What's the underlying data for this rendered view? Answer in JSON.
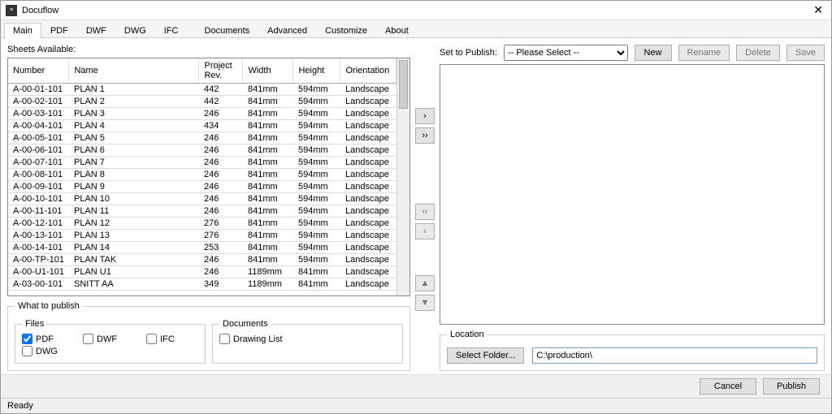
{
  "window": {
    "title": "Docuflow",
    "close_glyph": "✕"
  },
  "tabs": [
    "Main",
    "PDF",
    "DWF",
    "DWG",
    "IFC",
    "Documents",
    "Advanced",
    "Customize",
    "About"
  ],
  "active_tab": 0,
  "left": {
    "sheets_label": "Sheets Available:",
    "columns": {
      "number": "Number",
      "name": "Name",
      "rev": "Project Rev.",
      "width": "Width",
      "height": "Height",
      "orientation": "Orientation"
    },
    "rows": [
      {
        "num": "A-00-01-101",
        "name": "PLAN 1",
        "rev": "442",
        "w": "841mm",
        "h": "594mm",
        "o": "Landscape"
      },
      {
        "num": "A-00-02-101",
        "name": "PLAN 2",
        "rev": "442",
        "w": "841mm",
        "h": "594mm",
        "o": "Landscape"
      },
      {
        "num": "A-00-03-101",
        "name": "PLAN 3",
        "rev": "246",
        "w": "841mm",
        "h": "594mm",
        "o": "Landscape"
      },
      {
        "num": "A-00-04-101",
        "name": "PLAN 4",
        "rev": "434",
        "w": "841mm",
        "h": "594mm",
        "o": "Landscape"
      },
      {
        "num": "A-00-05-101",
        "name": "PLAN 5",
        "rev": "246",
        "w": "841mm",
        "h": "594mm",
        "o": "Landscape"
      },
      {
        "num": "A-00-06-101",
        "name": "PLAN 6",
        "rev": "246",
        "w": "841mm",
        "h": "594mm",
        "o": "Landscape"
      },
      {
        "num": "A-00-07-101",
        "name": "PLAN 7",
        "rev": "246",
        "w": "841mm",
        "h": "594mm",
        "o": "Landscape"
      },
      {
        "num": "A-00-08-101",
        "name": "PLAN 8",
        "rev": "246",
        "w": "841mm",
        "h": "594mm",
        "o": "Landscape"
      },
      {
        "num": "A-00-09-101",
        "name": "PLAN 9",
        "rev": "246",
        "w": "841mm",
        "h": "594mm",
        "o": "Landscape"
      },
      {
        "num": "A-00-10-101",
        "name": "PLAN 10",
        "rev": "246",
        "w": "841mm",
        "h": "594mm",
        "o": "Landscape"
      },
      {
        "num": "A-00-11-101",
        "name": "PLAN 11",
        "rev": "246",
        "w": "841mm",
        "h": "594mm",
        "o": "Landscape"
      },
      {
        "num": "A-00-12-101",
        "name": "PLAN 12",
        "rev": "276",
        "w": "841mm",
        "h": "594mm",
        "o": "Landscape"
      },
      {
        "num": "A-00-13-101",
        "name": "PLAN 13",
        "rev": "276",
        "w": "841mm",
        "h": "594mm",
        "o": "Landscape"
      },
      {
        "num": "A-00-14-101",
        "name": "PLAN 14",
        "rev": "253",
        "w": "841mm",
        "h": "594mm",
        "o": "Landscape"
      },
      {
        "num": "A-00-TP-101",
        "name": "PLAN TAK",
        "rev": "246",
        "w": "841mm",
        "h": "594mm",
        "o": "Landscape"
      },
      {
        "num": "A-00-U1-101",
        "name": "PLAN U1",
        "rev": "246",
        "w": "1189mm",
        "h": "841mm",
        "o": "Landscape"
      },
      {
        "num": "A-03-00-101",
        "name": "SNITT AA",
        "rev": "349",
        "w": "1189mm",
        "h": "841mm",
        "o": "Landscape"
      }
    ]
  },
  "mid_buttons": {
    "add_one": "›",
    "add_all": "››",
    "remove_all": "‹‹",
    "remove_one": "‹",
    "move_up": "▲",
    "move_down": "▼"
  },
  "right": {
    "set_label": "Set to Publish:",
    "select_placeholder": "-- Please Select --",
    "btn_new": "New",
    "btn_rename": "Rename",
    "btn_delete": "Delete",
    "btn_save": "Save",
    "location_legend": "Location",
    "select_folder": "Select Folder...",
    "folder_value": "C:\\production\\"
  },
  "publish": {
    "legend": "What to publish",
    "files_legend": "Files",
    "docs_legend": "Documents",
    "opts": {
      "pdf": "PDF",
      "dwf": "DWF",
      "ifc": "IFC",
      "dwg": "DWG",
      "drawing_list": "Drawing List"
    },
    "checked": {
      "pdf": true,
      "dwf": false,
      "ifc": false,
      "dwg": false,
      "drawing_list": false
    }
  },
  "footer": {
    "cancel": "Cancel",
    "publish": "Publish"
  },
  "status": "Ready"
}
